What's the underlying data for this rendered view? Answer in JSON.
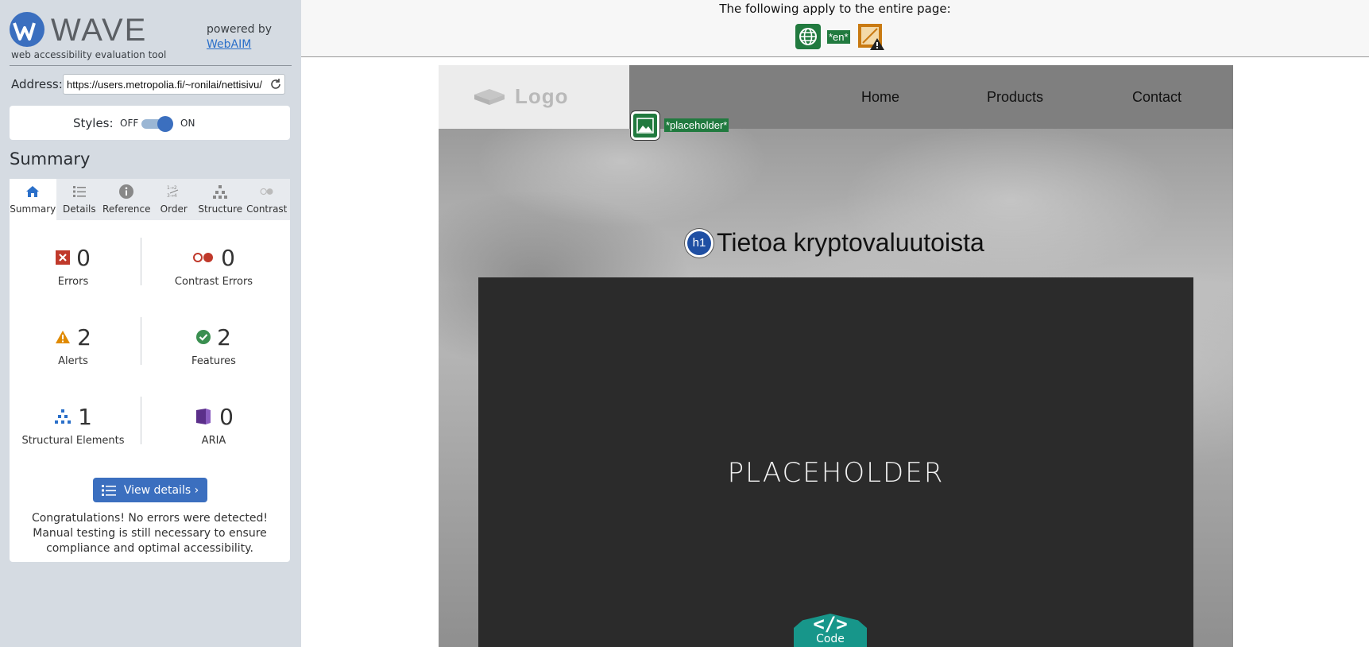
{
  "app": {
    "name": "WAVE",
    "subtitle": "web accessibility evaluation tool",
    "powered_by": "powered by",
    "powered_by_link": "WebAIM"
  },
  "address": {
    "label": "Address:",
    "value": "https://users.metropolia.fi/~ronilai/nettisivu/"
  },
  "styles": {
    "label": "Styles:",
    "off": "OFF",
    "on": "ON",
    "state": "on"
  },
  "summary": {
    "heading": "Summary",
    "tabs": [
      {
        "label": "Summary",
        "icon": "home-icon",
        "active": true
      },
      {
        "label": "Details",
        "icon": "list-icon",
        "active": false
      },
      {
        "label": "Reference",
        "icon": "info-icon",
        "active": false
      },
      {
        "label": "Order",
        "icon": "order-icon",
        "active": false
      },
      {
        "label": "Structure",
        "icon": "hierarchy-icon",
        "active": false
      },
      {
        "label": "Contrast",
        "icon": "contrast-icon",
        "active": false
      }
    ],
    "stats": {
      "errors": {
        "count": "0",
        "label": "Errors"
      },
      "contrast_errors": {
        "count": "0",
        "label": "Contrast Errors"
      },
      "alerts": {
        "count": "2",
        "label": "Alerts"
      },
      "features": {
        "count": "2",
        "label": "Features"
      },
      "structural": {
        "count": "1",
        "label": "Structural Elements"
      },
      "aria": {
        "count": "0",
        "label": "ARIA"
      }
    },
    "view_details": "View details ›",
    "message": "Congratulations! No errors were detected! Manual testing is still necessary to ensure compliance and optimal accessibility."
  },
  "banner": {
    "text": "The following apply to the entire page:",
    "icons": [
      "language-icon",
      "lang-tag",
      "page-alert-icon"
    ],
    "lang_tag": "*en*"
  },
  "site": {
    "logo": "Logo",
    "nav": [
      "Home",
      "Products",
      "Contact"
    ],
    "image_tag": "*placeholder*",
    "heading_badge": "h1",
    "heading": "Tietoa kryptovaluutoista",
    "placeholder": "PLACEHOLDER",
    "code_badge": {
      "glyph": "</>",
      "label": "Code"
    }
  },
  "colors": {
    "sidebar_bg": "#d5dbe2",
    "accent_blue": "#3b6fbf",
    "error_red": "#c0392b",
    "alert_orange": "#e08a00",
    "feature_green": "#3a8f50",
    "structure_blue": "#2a6fc9",
    "aria_purple": "#5b2f8a",
    "wave_green": "#217a3f",
    "code_teal": "#17968a"
  }
}
